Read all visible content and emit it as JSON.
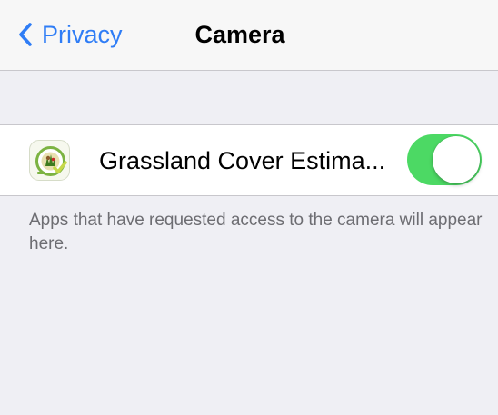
{
  "navbar": {
    "back_label": "Privacy",
    "title": "Camera"
  },
  "apps": [
    {
      "name": "Grassland Cover Estima...",
      "icon": "grassland-app-icon",
      "camera_access": true
    }
  ],
  "footer": "Apps that have requested access to the camera will appear here.",
  "colors": {
    "tint": "#2f7df6",
    "toggle_on": "#4cd964",
    "background": "#efeff4",
    "footer_text": "#6d6d72"
  }
}
